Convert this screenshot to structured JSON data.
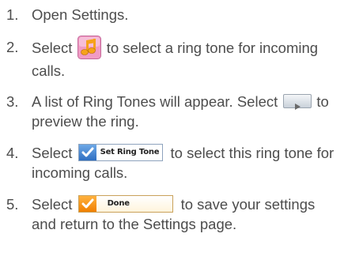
{
  "steps": [
    {
      "number": "1.",
      "text": "Open Settings."
    },
    {
      "number": "2.",
      "before": "Select",
      "after": "to select a ring tone for incoming calls."
    },
    {
      "number": "3.",
      "before": "A list of Ring Tones will appear. Select",
      "after": "to preview the ring."
    },
    {
      "number": "4.",
      "before": "Select",
      "after": "to select this ring tone for incoming calls."
    },
    {
      "number": "5.",
      "before": "Select",
      "after": "to save your settings and return to the Settings page."
    }
  ],
  "buttons": {
    "set_ring_tone_label": "Set Ring Tone",
    "done_label": "Done"
  },
  "icons": {
    "ringtone": "music-notes-icon",
    "play": "play-icon",
    "check": "check-icon"
  },
  "colors": {
    "text": "#4d4d4d",
    "check_blue": "#2f6fc2",
    "check_orange": "#f07f00",
    "ringtone_bg": "#f19bc4"
  }
}
